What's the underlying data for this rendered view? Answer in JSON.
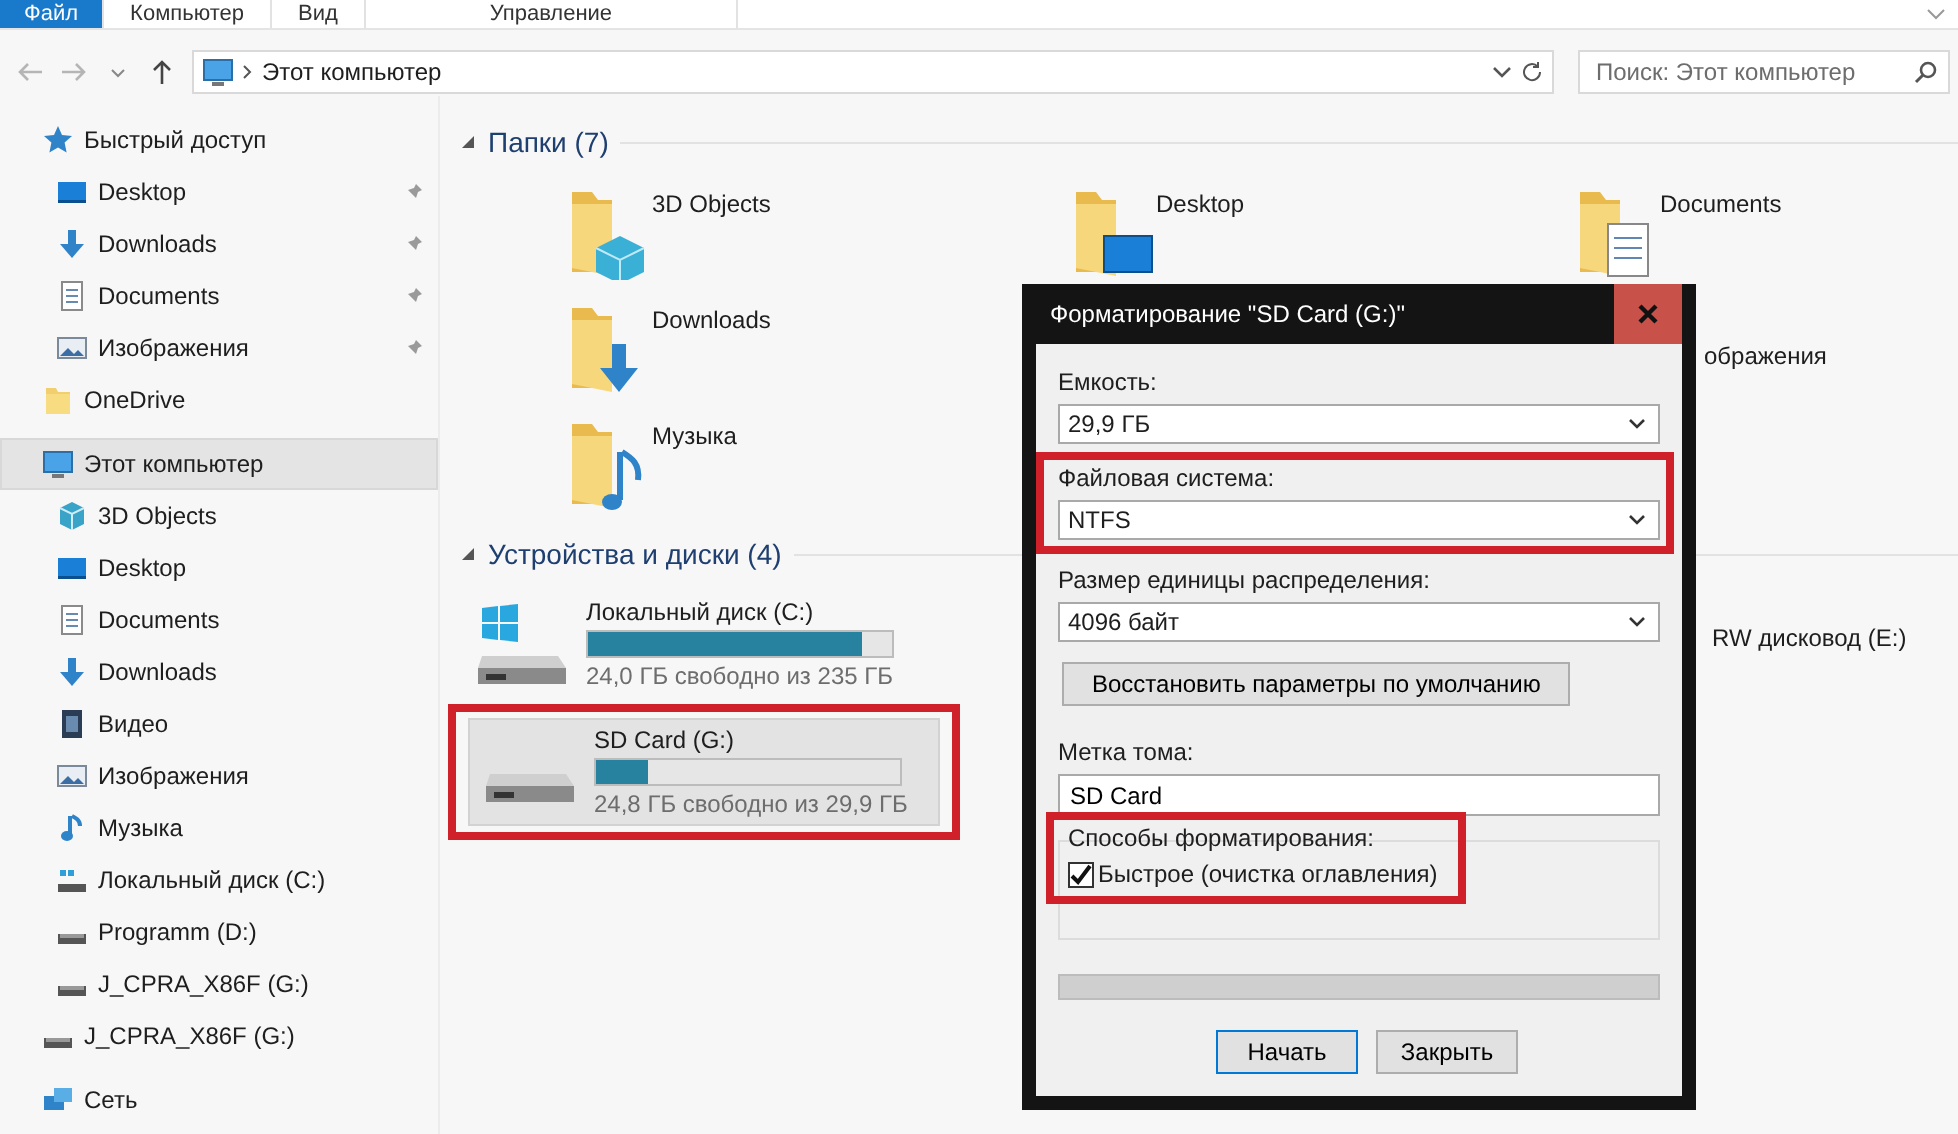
{
  "ribbon": {
    "tabs": [
      {
        "label": "Файл",
        "selected": true
      },
      {
        "label": "Компьютер",
        "selected": false
      },
      {
        "label": "Вид",
        "selected": false
      },
      {
        "label": "Управление",
        "selected": false
      }
    ]
  },
  "address_bar": {
    "path": "Этот компьютер"
  },
  "search": {
    "placeholder": "Поиск: Этот компьютер"
  },
  "sidebar": {
    "items": [
      {
        "label": "Быстрый доступ",
        "kind": "star",
        "selected": false,
        "children": [
          {
            "label": "Desktop",
            "kind": "desktop",
            "pinned": true,
            "selected": false
          },
          {
            "label": "Downloads",
            "kind": "downloads",
            "pinned": true,
            "selected": false
          },
          {
            "label": "Documents",
            "kind": "documents",
            "pinned": true,
            "selected": false
          },
          {
            "label": "Изображения",
            "kind": "pictures",
            "pinned": true,
            "selected": false
          }
        ]
      },
      {
        "label": "OneDrive",
        "kind": "folder",
        "selected": false
      },
      {
        "label": "Этот компьютер",
        "kind": "computer",
        "selected": true,
        "children": [
          {
            "label": "3D Objects",
            "kind": "cube",
            "selected": false
          },
          {
            "label": "Desktop",
            "kind": "desktop",
            "selected": false
          },
          {
            "label": "Documents",
            "kind": "documents",
            "selected": false
          },
          {
            "label": "Downloads",
            "kind": "downloads",
            "selected": false
          },
          {
            "label": "Видео",
            "kind": "video",
            "selected": false
          },
          {
            "label": "Изображения",
            "kind": "pictures",
            "selected": false
          },
          {
            "label": "Музыка",
            "kind": "music",
            "selected": false
          },
          {
            "label": "Локальный диск (C:)",
            "kind": "system_drive",
            "selected": false
          },
          {
            "label": "Programm (D:)",
            "kind": "drive",
            "selected": false
          },
          {
            "label": "J_CPRA_X86F (G:)",
            "kind": "drive",
            "selected": false
          }
        ]
      },
      {
        "label": "J_CPRA_X86F (G:)",
        "kind": "drive",
        "selected": false
      },
      {
        "label": "Сеть",
        "kind": "network",
        "selected": false
      }
    ]
  },
  "content": {
    "sections": [
      {
        "title": "Папки (7)",
        "kind": "folders",
        "expanded": true,
        "items": [
          {
            "name": "3D Objects",
            "kind": "cube"
          },
          {
            "name": "Desktop",
            "kind": "desktop"
          },
          {
            "name": "Documents",
            "kind": "documents"
          },
          {
            "name": "Downloads",
            "kind": "downloads"
          },
          {
            "name": "ображения",
            "kind": "clipped"
          },
          {
            "name": "Музыка",
            "kind": "music"
          }
        ]
      },
      {
        "title": "Устройства и диски (4)",
        "kind": "drives",
        "expanded": true,
        "items": [
          {
            "name": "Локальный диск (C:)",
            "kind": "system",
            "level": 0.9,
            "free": "24,0 ГБ свободно из 235 ГБ",
            "selected": false,
            "highlighted": false
          },
          {
            "name": "RW дисковод (E:)",
            "kind": "clipped"
          },
          {
            "name": "SD Card (G:)",
            "kind": "removable",
            "level": 0.17,
            "free": "24,8 ГБ свободно из 29,9 ГБ",
            "selected": true,
            "highlighted": true
          }
        ]
      }
    ]
  },
  "dialog": {
    "title": "Форматирование \"SD Card (G:)\"",
    "fields": [
      {
        "label": "Емкость:",
        "kind": "select",
        "value": "29,9 ГБ",
        "highlighted": false
      },
      {
        "label": "Файловая система:",
        "kind": "select",
        "value": "NTFS",
        "highlighted": true
      },
      {
        "label": "Размер единицы распределения:",
        "kind": "select",
        "value": "4096 байт",
        "highlighted": false
      },
      {
        "label": "Восстановить параметры по умолчанию",
        "kind": "button"
      },
      {
        "label": "Метка тома:",
        "kind": "input",
        "value": "SD Card",
        "highlighted": false
      }
    ],
    "options": {
      "title": "Способы форматирования:",
      "highlighted": true,
      "checkboxes": [
        {
          "label": "Быстрое (очистка оглавления)",
          "checked": true
        }
      ]
    },
    "progress": {
      "level": 0
    },
    "buttons": [
      {
        "label": "Начать",
        "default": true
      },
      {
        "label": "Закрыть",
        "default": false
      }
    ]
  }
}
